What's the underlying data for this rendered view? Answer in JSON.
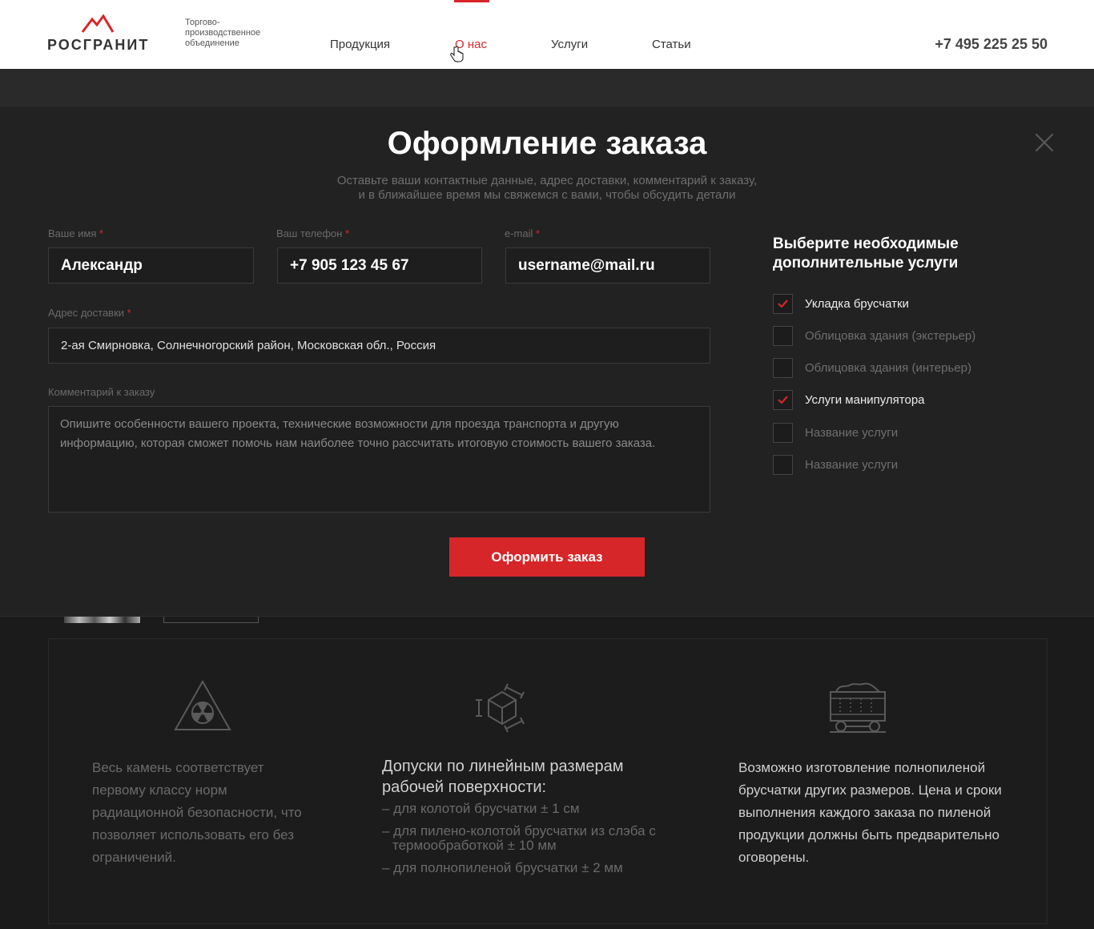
{
  "header": {
    "brand": "РОСГРАНИТ",
    "tagline": "Торгово-производственное объединение",
    "nav": [
      {
        "label": "Продукция",
        "active": false
      },
      {
        "label": "О нас",
        "active": true
      },
      {
        "label": "Услуги",
        "active": false
      },
      {
        "label": "Статьи",
        "active": false
      }
    ],
    "phone": "+7 495 225 25 50",
    "accent_color": "#d6262a"
  },
  "modal": {
    "title": "Оформление заказа",
    "subtitle_line1": "Оставьте ваши контактные данные, адрес доставки, комментарий к заказу,",
    "subtitle_line2": "и в ближайшее время мы свяжемся с вами, чтобы обсудить детали",
    "required_mark": "*",
    "fields": {
      "name": {
        "label": "Ваше имя",
        "value": "Александр"
      },
      "phone": {
        "label": "Ваш телефон",
        "value": "+7 905 123 45 67"
      },
      "email": {
        "label": "e-mail",
        "value": "username@mail.ru"
      },
      "address": {
        "label": "Адрес доставки",
        "value": "2-ая Смирновка, Солнечногорский район, Московская обл., Россия"
      },
      "comment": {
        "label": "Комментарий к заказу",
        "placeholder": "Опишите особенности вашего проекта, технические возможности для проезда транспорта и другую информацию, которая сможет помочь нам наиболее точно рассчитать итоговую стоимость вашего заказа."
      }
    },
    "submit_label": "Оформить заказ",
    "services_title": "Выберите необходимые дополнительные услуги",
    "services": [
      {
        "label": "Укладка брусчатки",
        "checked": true
      },
      {
        "label": "Облицовка здания (экстерьер)",
        "checked": false
      },
      {
        "label": "Облицовка здания (интерьер)",
        "checked": false
      },
      {
        "label": "Услуги манипулятора",
        "checked": true
      },
      {
        "label": "Название услуги",
        "checked": false
      },
      {
        "label": "Название услуги",
        "checked": false
      }
    ]
  },
  "features": {
    "radiation": {
      "icon": "radiation-icon",
      "text": "Весь камень соответствует первому классу норм радиационной безопасности, что позволяет использовать его без ограничений."
    },
    "tolerances": {
      "icon": "cube-dimensions-icon",
      "title": "Допуски по линейным размерам рабочей поверхности:",
      "items": [
        "– для колотой брусчатки ± 1 см",
        "– для пилено-колотой брусчатки из слэба с термообработкой ± 10 мм",
        "– для полнопиленой брусчатки ± 2 мм"
      ]
    },
    "custom": {
      "icon": "mine-cart-icon",
      "text": "Возможно изготовление полнопиленой брусчатки других размеров. Цена и сроки выполнения каждого заказа по пиленой продукции должны быть предварительно оговорены."
    }
  }
}
